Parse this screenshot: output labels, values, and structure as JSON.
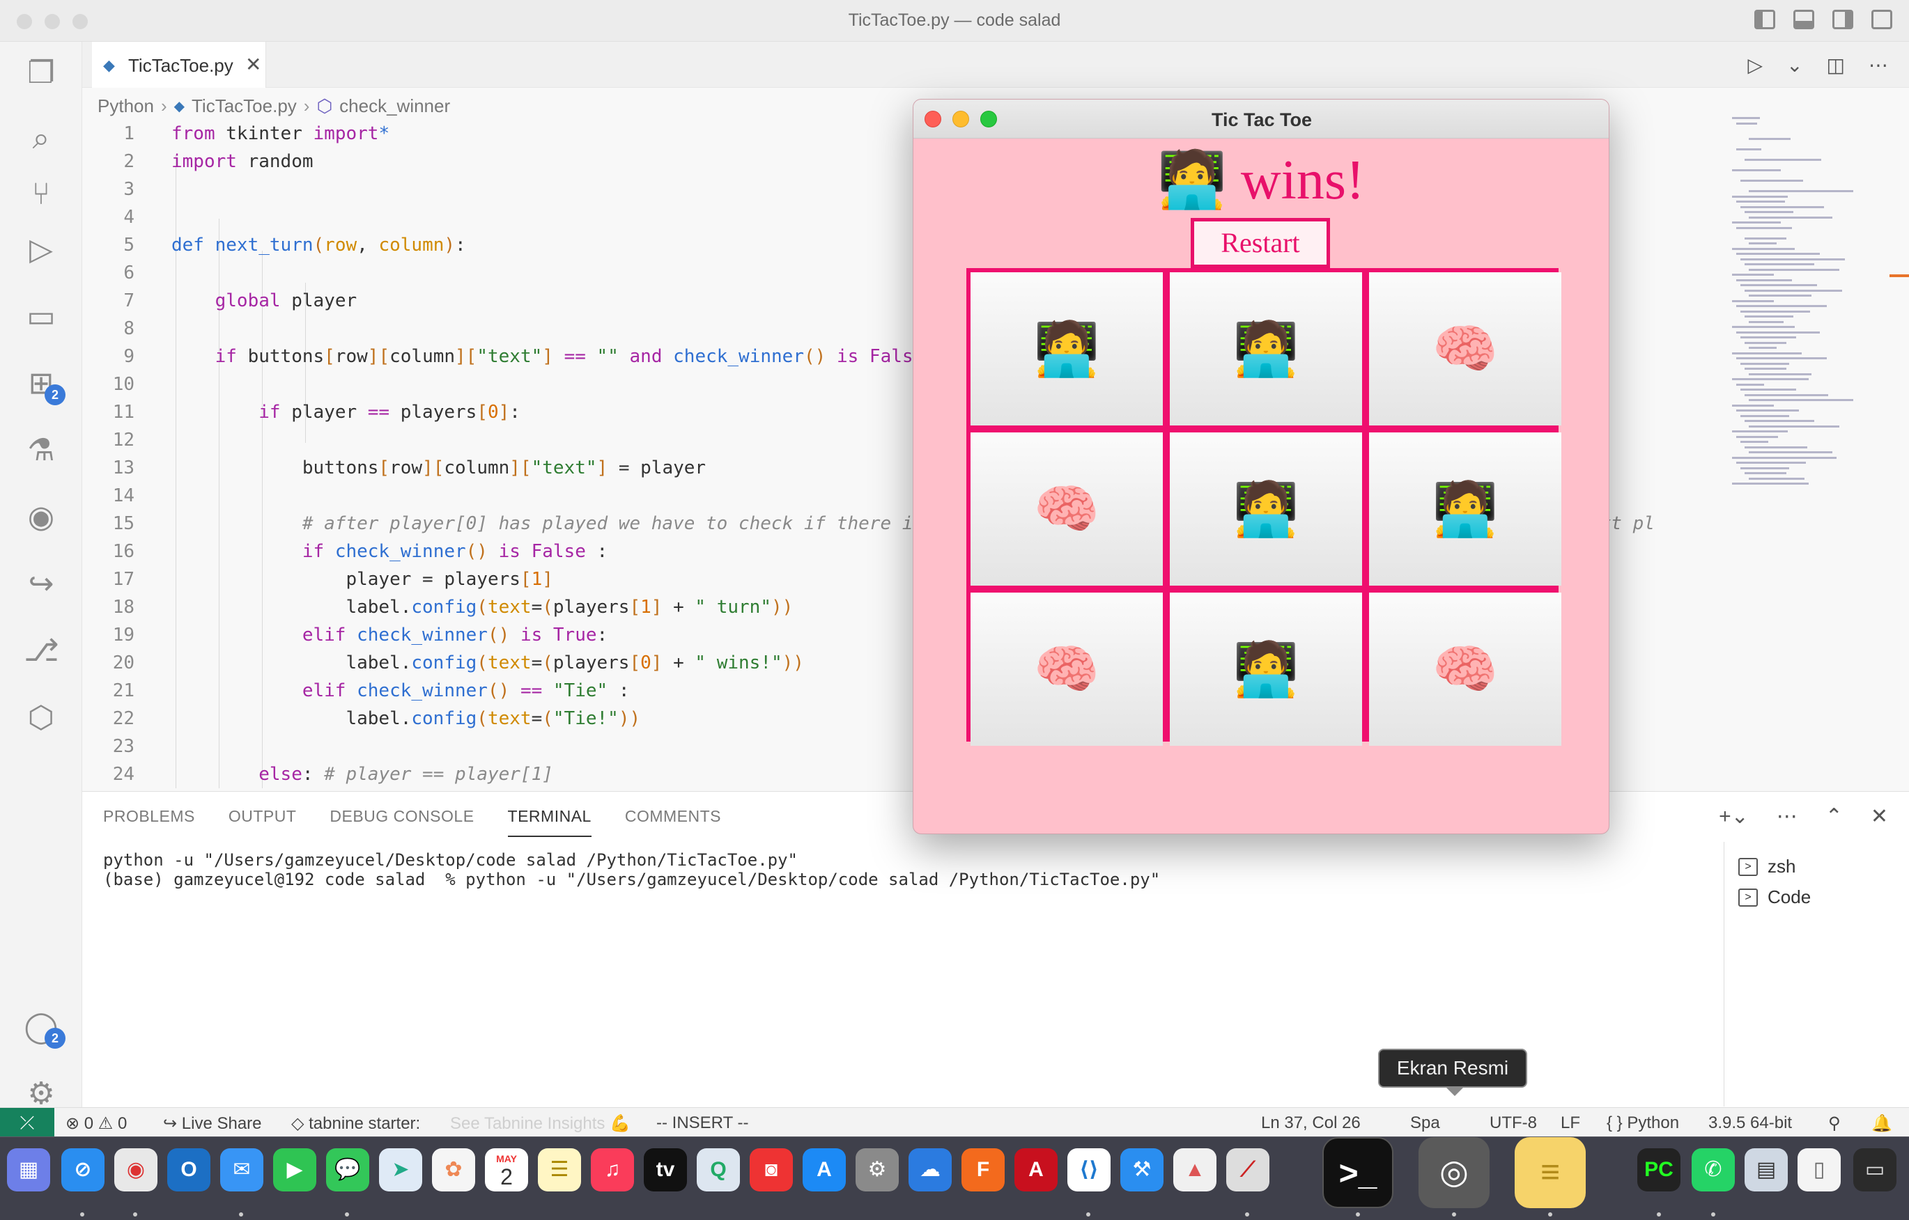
{
  "window_title": "TicTacToe.py — code salad",
  "activity_badges": {
    "extensions": "2",
    "accounts": "2"
  },
  "tab": {
    "label": "TicTacToe.py",
    "close": "✕"
  },
  "breadcrumb": [
    "Python",
    "TicTacToe.py",
    "check_winner"
  ],
  "code_lines": [
    {
      "n": "1",
      "html": "<span class='kw'>from</span> tkinter <span class='kw'>import</span><span class='fn'>*</span>"
    },
    {
      "n": "2",
      "html": "<span class='kw'>import</span> random"
    },
    {
      "n": "3",
      "html": ""
    },
    {
      "n": "4",
      "html": ""
    },
    {
      "n": "5",
      "html": "<span class='fn'>def</span> <span class='fn'>next_turn</span><span class='br'>(</span><span class='prm'>row</span>, <span class='prm'>column</span><span class='br'>)</span>:"
    },
    {
      "n": "6",
      "html": ""
    },
    {
      "n": "7",
      "html": "    <span class='kw'>global</span> player"
    },
    {
      "n": "8",
      "html": ""
    },
    {
      "n": "9",
      "html": "    <span class='kw'>if</span> buttons<span class='br'>[</span>row<span class='br'>][</span>column<span class='br'>][</span><span class='str'>\"text\"</span><span class='br'>]</span> <span class='kw'>==</span> <span class='str'>\"\"</span> <span class='kw'>and</span> <span class='fn'>check_winner</span><span class='br'>()</span> <span class='kw'>is</span> <span class='kw'>False</span>"
    },
    {
      "n": "10",
      "html": ""
    },
    {
      "n": "11",
      "html": "        <span class='kw'>if</span> player <span class='kw'>==</span> players<span class='br'>[</span><span class='num'>0</span><span class='br'>]</span>:"
    },
    {
      "n": "12",
      "html": ""
    },
    {
      "n": "13",
      "html": "            buttons<span class='br'>[</span>row<span class='br'>][</span>column<span class='br'>][</span><span class='str'>\"text\"</span><span class='br'>]</span> = player"
    },
    {
      "n": "14",
      "html": ""
    },
    {
      "n": "15",
      "html": "            <span class='cm'># after player[0] has played we have to check if there i</span>                                                          <span class='cm'>he next pl</span>"
    },
    {
      "n": "16",
      "html": "            <span class='kw'>if</span> <span class='fn'>check_winner</span><span class='br'>()</span> <span class='kw'>is</span> <span class='kw'>False</span> :"
    },
    {
      "n": "17",
      "html": "                player = players<span class='br'>[</span><span class='num'>1</span><span class='br'>]</span>"
    },
    {
      "n": "18",
      "html": "                label.<span class='fn'>config</span><span class='br'>(</span><span class='prm'>text</span>=<span class='br'>(</span>players<span class='br'>[</span><span class='num'>1</span><span class='br'>]</span> + <span class='str'>\" turn\"</span><span class='br'>))</span>"
    },
    {
      "n": "19",
      "html": "            <span class='kw'>elif</span> <span class='fn'>check_winner</span><span class='br'>()</span> <span class='kw'>is</span> <span class='kw'>True</span>:"
    },
    {
      "n": "20",
      "html": "                label.<span class='fn'>config</span><span class='br'>(</span><span class='prm'>text</span>=<span class='br'>(</span>players<span class='br'>[</span><span class='num'>0</span><span class='br'>]</span> + <span class='str'>\" wins!\"</span><span class='br'>))</span>"
    },
    {
      "n": "21",
      "html": "            <span class='kw'>elif</span> <span class='fn'>check_winner</span><span class='br'>()</span> <span class='kw'>==</span> <span class='str'>\"Tie\"</span> :"
    },
    {
      "n": "22",
      "html": "                label.<span class='fn'>config</span><span class='br'>(</span><span class='prm'>text</span>=<span class='br'>(</span><span class='str'>\"Tie!\"</span><span class='br'>))</span>"
    },
    {
      "n": "23",
      "html": ""
    },
    {
      "n": "24",
      "html": "        <span class='kw'>else</span>: <span class='cm'># player == player[1]</span>"
    }
  ],
  "panel": {
    "tabs": [
      "PROBLEMS",
      "OUTPUT",
      "DEBUG CONSOLE",
      "TERMINAL",
      "COMMENTS"
    ],
    "active_tab": "TERMINAL",
    "terminal_lines": [
      "python -u \"/Users/gamzeyucel/Desktop/code salad /Python/TicTacToe.py\"",
      "(base) gamzeyucel@192 code salad  % python -u \"/Users/gamzeyucel/Desktop/code salad /Python/TicTacToe.py\""
    ],
    "terminals": [
      "zsh",
      "Code"
    ]
  },
  "status": {
    "errors": "0",
    "warnings": "0",
    "live_share": "Live Share",
    "tabnine": "tabnine starter:",
    "tabnine_insights": "See Tabnine Insights 💪",
    "mode": "-- INSERT --",
    "position": "Ln 37, Col 26",
    "spaces": "Spa",
    "encoding": "UTF-8",
    "eol": "LF",
    "language": "Python",
    "interpreter": "3.9.5 64-bit"
  },
  "game": {
    "window_title": "Tic Tac Toe",
    "status_label": "🧑‍💻 wins!",
    "restart_label": "Restart",
    "cells": [
      "🧑‍💻",
      "🧑‍💻",
      "🧠",
      "🧠",
      "🧑‍💻",
      "🧑‍💻",
      "🧠",
      "🧑‍💻",
      "🧠"
    ]
  },
  "dock": {
    "tooltip": "Ekran Resmi",
    "calendar_month": "MAY",
    "calendar_day": "2"
  },
  "colors": {
    "game_bg": "#ffc0cb",
    "accent": "#e8106a"
  }
}
